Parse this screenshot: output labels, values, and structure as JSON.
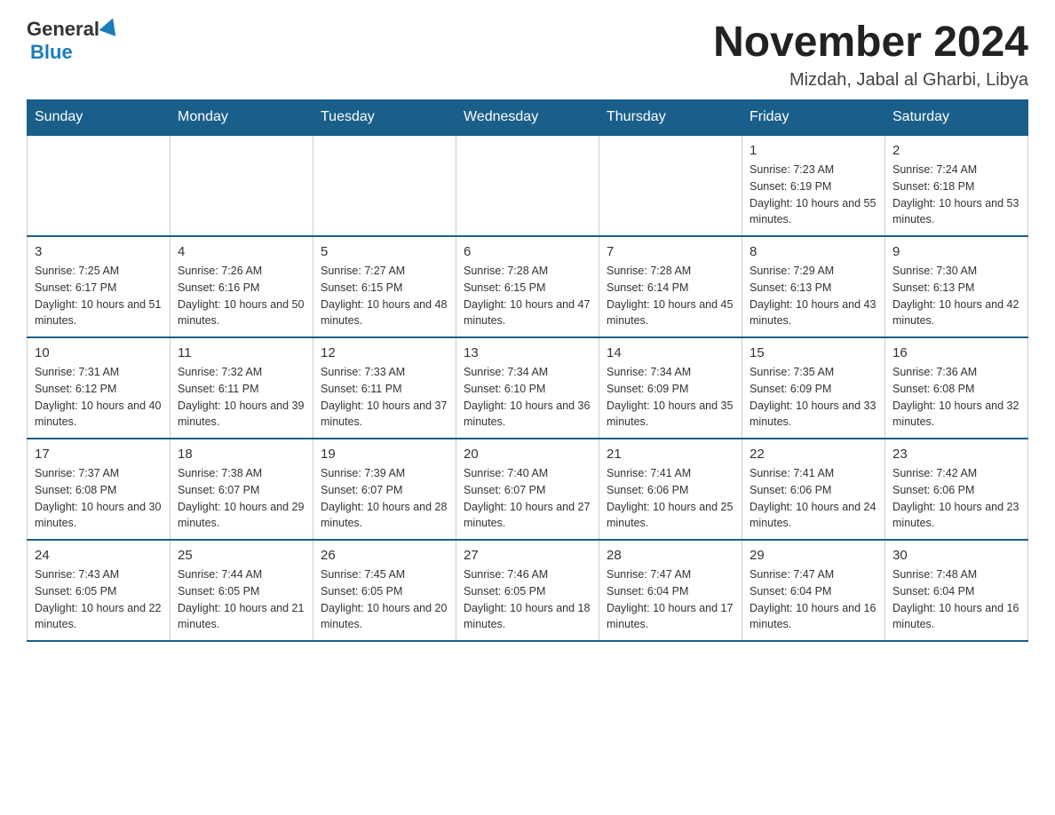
{
  "logo": {
    "general": "General",
    "blue": "Blue"
  },
  "title": "November 2024",
  "location": "Mizdah, Jabal al Gharbi, Libya",
  "days_of_week": [
    "Sunday",
    "Monday",
    "Tuesday",
    "Wednesday",
    "Thursday",
    "Friday",
    "Saturday"
  ],
  "weeks": [
    [
      {
        "day": "",
        "info": ""
      },
      {
        "day": "",
        "info": ""
      },
      {
        "day": "",
        "info": ""
      },
      {
        "day": "",
        "info": ""
      },
      {
        "day": "",
        "info": ""
      },
      {
        "day": "1",
        "info": "Sunrise: 7:23 AM\nSunset: 6:19 PM\nDaylight: 10 hours and 55 minutes."
      },
      {
        "day": "2",
        "info": "Sunrise: 7:24 AM\nSunset: 6:18 PM\nDaylight: 10 hours and 53 minutes."
      }
    ],
    [
      {
        "day": "3",
        "info": "Sunrise: 7:25 AM\nSunset: 6:17 PM\nDaylight: 10 hours and 51 minutes."
      },
      {
        "day": "4",
        "info": "Sunrise: 7:26 AM\nSunset: 6:16 PM\nDaylight: 10 hours and 50 minutes."
      },
      {
        "day": "5",
        "info": "Sunrise: 7:27 AM\nSunset: 6:15 PM\nDaylight: 10 hours and 48 minutes."
      },
      {
        "day": "6",
        "info": "Sunrise: 7:28 AM\nSunset: 6:15 PM\nDaylight: 10 hours and 47 minutes."
      },
      {
        "day": "7",
        "info": "Sunrise: 7:28 AM\nSunset: 6:14 PM\nDaylight: 10 hours and 45 minutes."
      },
      {
        "day": "8",
        "info": "Sunrise: 7:29 AM\nSunset: 6:13 PM\nDaylight: 10 hours and 43 minutes."
      },
      {
        "day": "9",
        "info": "Sunrise: 7:30 AM\nSunset: 6:13 PM\nDaylight: 10 hours and 42 minutes."
      }
    ],
    [
      {
        "day": "10",
        "info": "Sunrise: 7:31 AM\nSunset: 6:12 PM\nDaylight: 10 hours and 40 minutes."
      },
      {
        "day": "11",
        "info": "Sunrise: 7:32 AM\nSunset: 6:11 PM\nDaylight: 10 hours and 39 minutes."
      },
      {
        "day": "12",
        "info": "Sunrise: 7:33 AM\nSunset: 6:11 PM\nDaylight: 10 hours and 37 minutes."
      },
      {
        "day": "13",
        "info": "Sunrise: 7:34 AM\nSunset: 6:10 PM\nDaylight: 10 hours and 36 minutes."
      },
      {
        "day": "14",
        "info": "Sunrise: 7:34 AM\nSunset: 6:09 PM\nDaylight: 10 hours and 35 minutes."
      },
      {
        "day": "15",
        "info": "Sunrise: 7:35 AM\nSunset: 6:09 PM\nDaylight: 10 hours and 33 minutes."
      },
      {
        "day": "16",
        "info": "Sunrise: 7:36 AM\nSunset: 6:08 PM\nDaylight: 10 hours and 32 minutes."
      }
    ],
    [
      {
        "day": "17",
        "info": "Sunrise: 7:37 AM\nSunset: 6:08 PM\nDaylight: 10 hours and 30 minutes."
      },
      {
        "day": "18",
        "info": "Sunrise: 7:38 AM\nSunset: 6:07 PM\nDaylight: 10 hours and 29 minutes."
      },
      {
        "day": "19",
        "info": "Sunrise: 7:39 AM\nSunset: 6:07 PM\nDaylight: 10 hours and 28 minutes."
      },
      {
        "day": "20",
        "info": "Sunrise: 7:40 AM\nSunset: 6:07 PM\nDaylight: 10 hours and 27 minutes."
      },
      {
        "day": "21",
        "info": "Sunrise: 7:41 AM\nSunset: 6:06 PM\nDaylight: 10 hours and 25 minutes."
      },
      {
        "day": "22",
        "info": "Sunrise: 7:41 AM\nSunset: 6:06 PM\nDaylight: 10 hours and 24 minutes."
      },
      {
        "day": "23",
        "info": "Sunrise: 7:42 AM\nSunset: 6:06 PM\nDaylight: 10 hours and 23 minutes."
      }
    ],
    [
      {
        "day": "24",
        "info": "Sunrise: 7:43 AM\nSunset: 6:05 PM\nDaylight: 10 hours and 22 minutes."
      },
      {
        "day": "25",
        "info": "Sunrise: 7:44 AM\nSunset: 6:05 PM\nDaylight: 10 hours and 21 minutes."
      },
      {
        "day": "26",
        "info": "Sunrise: 7:45 AM\nSunset: 6:05 PM\nDaylight: 10 hours and 20 minutes."
      },
      {
        "day": "27",
        "info": "Sunrise: 7:46 AM\nSunset: 6:05 PM\nDaylight: 10 hours and 18 minutes."
      },
      {
        "day": "28",
        "info": "Sunrise: 7:47 AM\nSunset: 6:04 PM\nDaylight: 10 hours and 17 minutes."
      },
      {
        "day": "29",
        "info": "Sunrise: 7:47 AM\nSunset: 6:04 PM\nDaylight: 10 hours and 16 minutes."
      },
      {
        "day": "30",
        "info": "Sunrise: 7:48 AM\nSunset: 6:04 PM\nDaylight: 10 hours and 16 minutes."
      }
    ]
  ]
}
